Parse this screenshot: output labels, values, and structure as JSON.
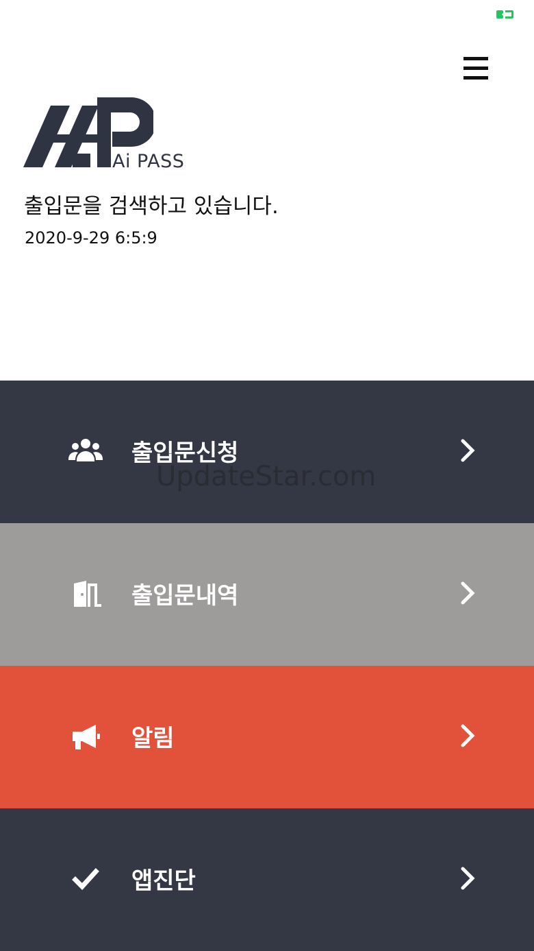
{
  "app": {
    "logo_text": "Ai PASS",
    "status_message": "출입문을 검색하고 있습니다.",
    "timestamp": "2020-9-29 6:5:9"
  },
  "status_bar": {
    "battery_icon": "battery-icon"
  },
  "header": {
    "menu_icon": "hamburger-menu-icon"
  },
  "menu": {
    "items": [
      {
        "label": "출입문신청",
        "icon": "users-icon",
        "color": "#343845"
      },
      {
        "label": "출입문내역",
        "icon": "door-icon",
        "color": "#9e9b9b"
      },
      {
        "label": "알림",
        "icon": "megaphone-icon",
        "color": "#e2523a"
      },
      {
        "label": "앱진단",
        "icon": "checkmark-icon",
        "color": "#343845"
      }
    ]
  },
  "watermark": "UpdateStar.com"
}
